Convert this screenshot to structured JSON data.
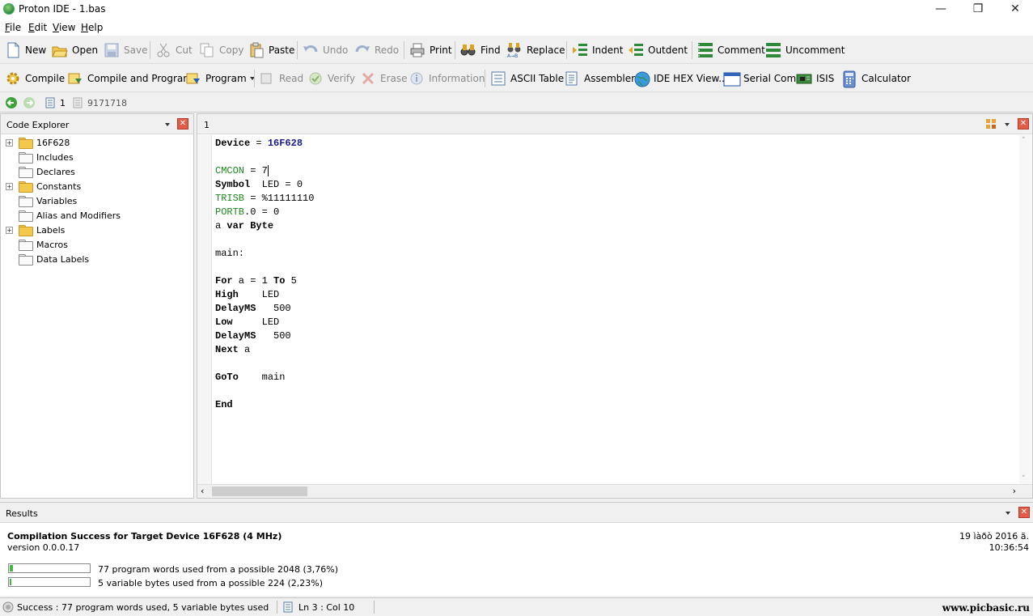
{
  "window": {
    "title": "Proton IDE - 1.bas",
    "minimize": "—",
    "maximize": "❐",
    "close": "✕"
  },
  "menu": [
    {
      "key": "F",
      "rest": "ile"
    },
    {
      "key": "E",
      "rest": "dit"
    },
    {
      "key": "V",
      "rest": "iew"
    },
    {
      "key": "H",
      "rest": "elp"
    }
  ],
  "toolbar1": {
    "new": "New",
    "open": "Open",
    "save": "Save",
    "cut": "Cut",
    "copy": "Copy",
    "paste": "Paste",
    "undo": "Undo",
    "redo": "Redo",
    "print": "Print",
    "find": "Find",
    "replace": "Replace",
    "indent": "Indent",
    "outdent": "Outdent",
    "comment": "Comment",
    "uncomment": "Uncomment"
  },
  "toolbar2": {
    "compile": "Compile",
    "compile_program": "Compile and Program",
    "program": "Program",
    "read": "Read",
    "verify": "Verify",
    "erase": "Erase",
    "information": "Information",
    "ascii": "ASCII Table",
    "assembler": "Assembler",
    "hexview": "IDE HEX View...",
    "serial": "Serial Com",
    "isis": "ISIS",
    "calculator": "Calculator"
  },
  "nav": {
    "doc_index": "1",
    "doc_id": "9171718"
  },
  "explorer": {
    "title": "Code Explorer",
    "items": [
      {
        "label": "16F628",
        "expandable": true,
        "folder": "yellow"
      },
      {
        "label": "Includes",
        "expandable": false,
        "folder": "white"
      },
      {
        "label": "Declares",
        "expandable": false,
        "folder": "white"
      },
      {
        "label": "Constants",
        "expandable": true,
        "folder": "yellow"
      },
      {
        "label": "Variables",
        "expandable": false,
        "folder": "white"
      },
      {
        "label": "Alias and Modifiers",
        "expandable": false,
        "folder": "white"
      },
      {
        "label": "Labels",
        "expandable": true,
        "folder": "yellow"
      },
      {
        "label": "Macros",
        "expandable": false,
        "folder": "white"
      },
      {
        "label": "Data Labels",
        "expandable": false,
        "folder": "white"
      }
    ]
  },
  "editor": {
    "tab": "1",
    "lines": [
      "Device = 16F628",
      "",
      "CMCON = 7",
      "Symbol  LED = 0",
      "TRISB = %11111110",
      "PORTB.0 = 0",
      "a var Byte",
      "",
      "main:",
      "",
      "For a = 1 To 5",
      "High    LED",
      "DelayMS   500",
      "Low     LED",
      "DelayMS   500",
      "Next a",
      "",
      "GoTo    main",
      "",
      "End"
    ]
  },
  "results": {
    "title": "Results",
    "headline": "Compilation Success for Target Device 16F628 (4 MHz)",
    "version": "version 0.0.0.17",
    "date": "19 ìàðò 2016 ã.",
    "time": "10:36:54",
    "usage": [
      {
        "text": "77 program words used from a possible 2048 (3,76%)",
        "fraction": 0.0376
      },
      {
        "text": "5 variable bytes used from a possible 224 (2,23%)",
        "fraction": 0.0223
      }
    ]
  },
  "status": {
    "message": "Success : 77 program words used, 5 variable bytes used",
    "position": "Ln 3 : Col 10",
    "watermark": "www.picbasic.ru"
  }
}
